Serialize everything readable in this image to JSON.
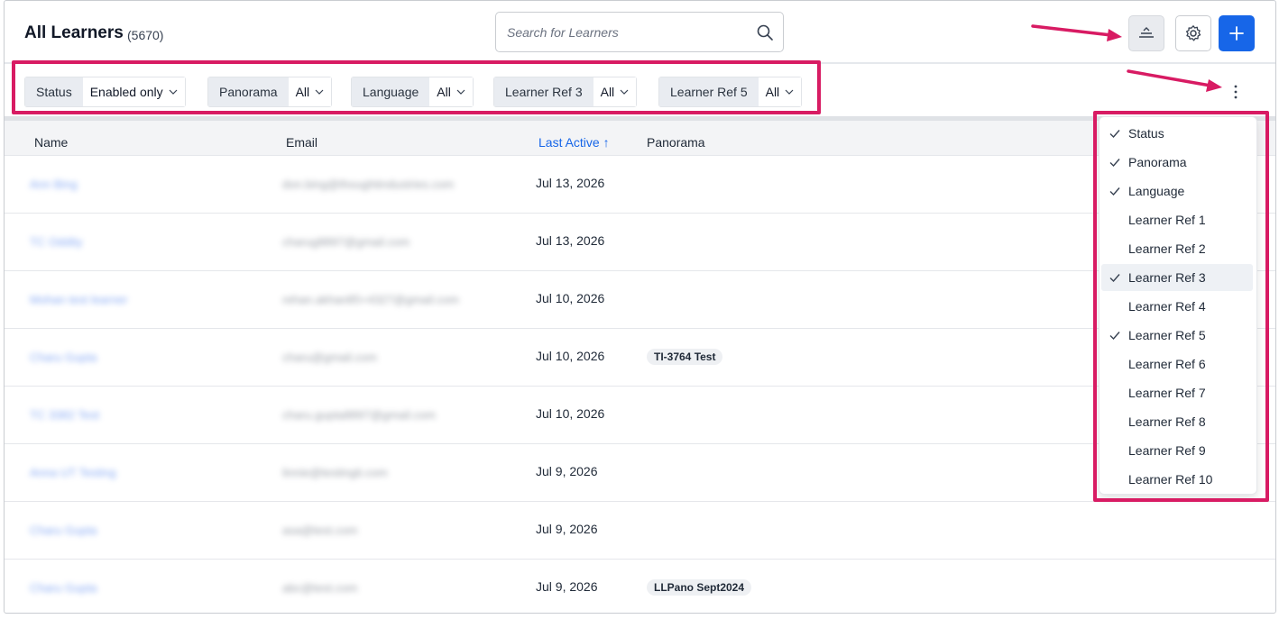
{
  "header": {
    "title": "All Learners",
    "count": "(5670)",
    "search_placeholder": "Search for Learners"
  },
  "filters": [
    {
      "label": "Status",
      "value": "Enabled only"
    },
    {
      "label": "Panorama",
      "value": "All"
    },
    {
      "label": "Language",
      "value": "All"
    },
    {
      "label": "Learner Ref 3",
      "value": "All"
    },
    {
      "label": "Learner Ref 5",
      "value": "All"
    }
  ],
  "table": {
    "columns": {
      "name": "Name",
      "email": "Email",
      "last_active": "Last Active ↑",
      "panorama": "Panorama"
    },
    "rows": [
      {
        "name": "Ann Bing",
        "email": "don.bing@thoughtindustries.com",
        "last_active": "Jul 13, 2026",
        "panorama": ""
      },
      {
        "name": "TC Oddity",
        "email": "charug8897@gmail.com",
        "last_active": "Jul 13, 2026",
        "panorama": ""
      },
      {
        "name": "Mohan test learner",
        "email": "rehan.akhan85+4327@gmail.com",
        "last_active": "Jul 10, 2026",
        "panorama": ""
      },
      {
        "name": "Charu Gupta",
        "email": "charu@gmail.com",
        "last_active": "Jul 10, 2026",
        "panorama": "TI-3764 Test"
      },
      {
        "name": "TC 3382 Test",
        "email": "charu.gupta8897@gmail.com",
        "last_active": "Jul 10, 2026",
        "panorama": ""
      },
      {
        "name": "Anna UT Testing",
        "email": "linnie@testingti.com",
        "last_active": "Jul 9, 2026",
        "panorama": ""
      },
      {
        "name": "Charu Gupta",
        "email": "asa@test.com",
        "last_active": "Jul 9, 2026",
        "panorama": ""
      },
      {
        "name": "Charu Gupta",
        "email": "abc@test.com",
        "last_active": "Jul 9, 2026",
        "panorama": "LLPano Sept2024"
      }
    ]
  },
  "column_menu": [
    {
      "label": "Status",
      "checked": true
    },
    {
      "label": "Panorama",
      "checked": true
    },
    {
      "label": "Language",
      "checked": true
    },
    {
      "label": "Learner Ref 1",
      "checked": false
    },
    {
      "label": "Learner Ref 2",
      "checked": false
    },
    {
      "label": "Learner Ref 3",
      "checked": true
    },
    {
      "label": "Learner Ref 4",
      "checked": false
    },
    {
      "label": "Learner Ref 5",
      "checked": true
    },
    {
      "label": "Learner Ref 6",
      "checked": false
    },
    {
      "label": "Learner Ref 7",
      "checked": false
    },
    {
      "label": "Learner Ref 8",
      "checked": false
    },
    {
      "label": "Learner Ref 9",
      "checked": false
    },
    {
      "label": "Learner Ref 10",
      "checked": false
    }
  ],
  "icons": {
    "search": "search-icon",
    "density": "density-icon",
    "settings": "gear-icon",
    "add": "plus-icon",
    "more": "kebab-icon",
    "check": "check-icon",
    "chevron": "chevron-down-icon"
  },
  "colors": {
    "accent": "#1766e8",
    "annotation": "#d81b63",
    "link": "#2563eb"
  }
}
